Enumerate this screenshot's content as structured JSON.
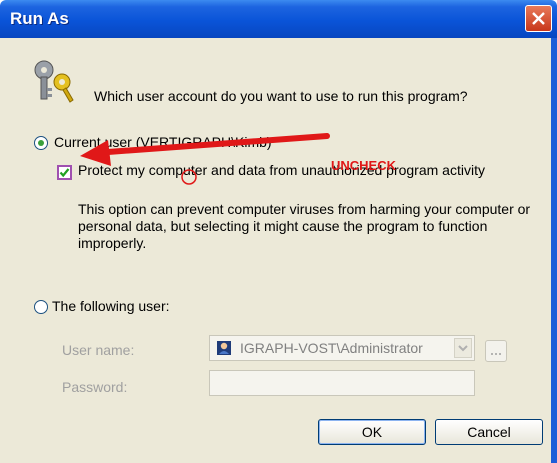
{
  "window": {
    "title": "Run As"
  },
  "prompt": {
    "question": "Which user account do you want to use to run this program?"
  },
  "options": {
    "current_user_label": "Current user (VERTIGRAPH\\Kimb)",
    "protect_label": "Protect my computer and data from unauthorized program activity",
    "description": "This option can prevent computer viruses from harming your computer or personal data, but selecting it might cause the program to function improperly.",
    "following_user_label": "The following user:"
  },
  "fields": {
    "username_label": "User name:",
    "username_value": "IGRAPH-VOST\\Administrator",
    "password_label": "Password:",
    "password_value": "",
    "browse_label": "..."
  },
  "buttons": {
    "ok": "OK",
    "cancel": "Cancel"
  },
  "annotation": {
    "label": "UNCHECK"
  },
  "colors": {
    "titlebar": "#0a54d8",
    "annotation": "#e01818",
    "dialog_bg": "#ece9d8"
  },
  "icons": [
    "keys-icon",
    "close-icon",
    "user-icon",
    "chevron-down-icon",
    "checkmark-icon"
  ]
}
